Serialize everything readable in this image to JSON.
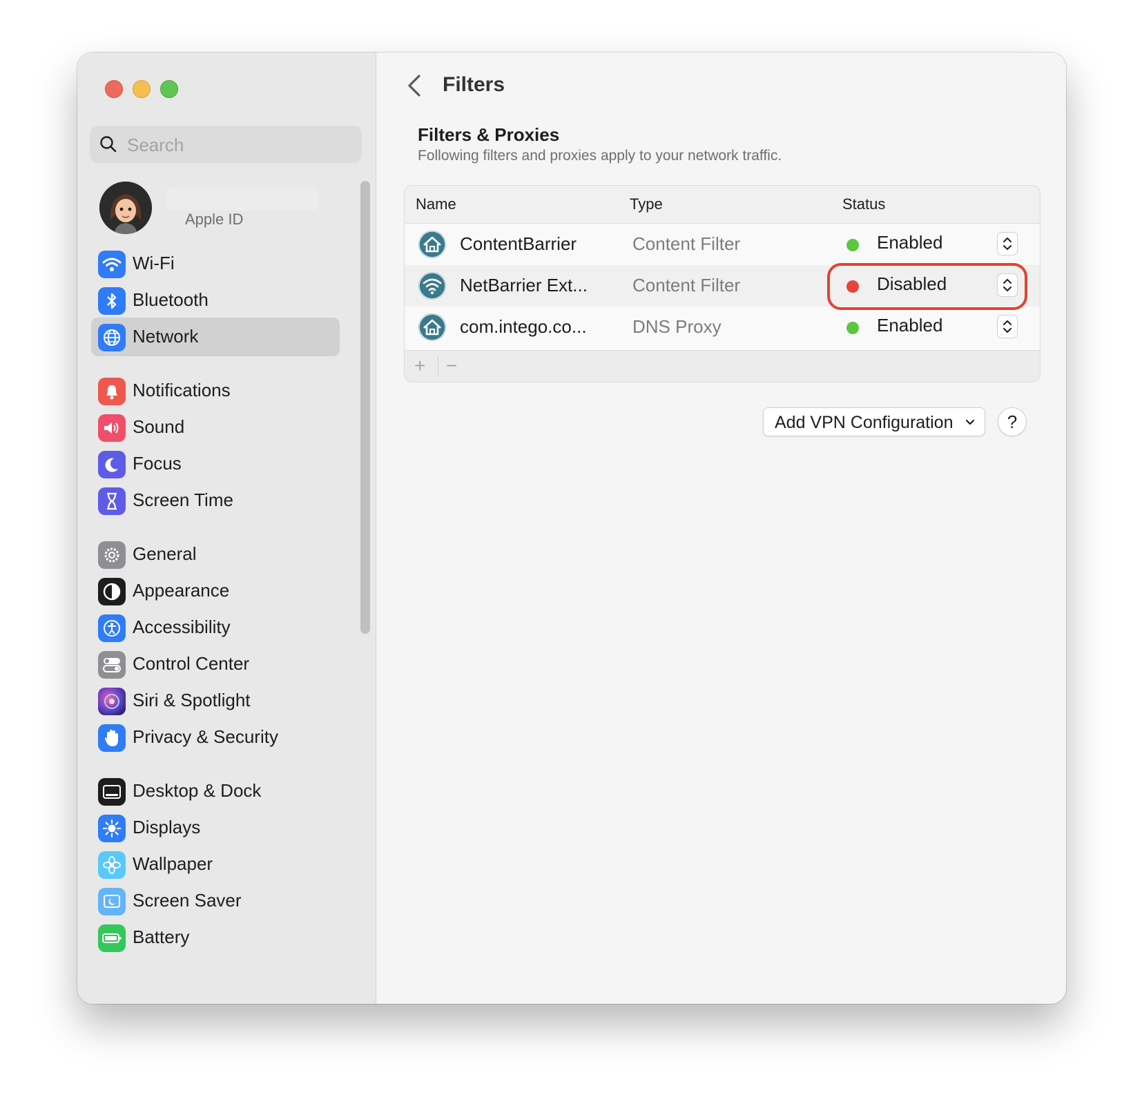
{
  "window": {
    "traffic_lights": [
      "close",
      "minimize",
      "zoom"
    ]
  },
  "sidebar": {
    "search_placeholder": "Search",
    "account_label": "Apple ID",
    "items": [
      {
        "label": "Wi-Fi",
        "icon": "wifi-icon",
        "color": "#2f7cf6",
        "selected": false
      },
      {
        "label": "Bluetooth",
        "icon": "bluetooth-icon",
        "color": "#2f7cf6",
        "selected": false
      },
      {
        "label": "Network",
        "icon": "globe-icon",
        "color": "#2f7cf6",
        "selected": true
      },
      {
        "label": "Notifications",
        "icon": "bell-icon",
        "color": "#f0584f",
        "selected": false
      },
      {
        "label": "Sound",
        "icon": "speaker-icon",
        "color": "#ef4f6a",
        "selected": false
      },
      {
        "label": "Focus",
        "icon": "moon-icon",
        "color": "#5e5ce6",
        "selected": false
      },
      {
        "label": "Screen Time",
        "icon": "hourglass-icon",
        "color": "#5e5ce6",
        "selected": false
      },
      {
        "label": "General",
        "icon": "gear-icon",
        "color": "#8e8e93",
        "selected": false
      },
      {
        "label": "Appearance",
        "icon": "appearance-icon",
        "color": "#1d1d1f",
        "selected": false
      },
      {
        "label": "Accessibility",
        "icon": "accessibility-icon",
        "color": "#2f7cf6",
        "selected": false
      },
      {
        "label": "Control Center",
        "icon": "toggles-icon",
        "color": "#8e8e93",
        "selected": false
      },
      {
        "label": "Siri & Spotlight",
        "icon": "siri-icon",
        "color": "#6b3fa0",
        "selected": false
      },
      {
        "label": "Privacy & Security",
        "icon": "hand-icon",
        "color": "#2f7cf6",
        "selected": false
      },
      {
        "label": "Desktop & Dock",
        "icon": "dock-icon",
        "color": "#1d1d1f",
        "selected": false
      },
      {
        "label": "Displays",
        "icon": "sun-icon",
        "color": "#2f7cf6",
        "selected": false
      },
      {
        "label": "Wallpaper",
        "icon": "flower-icon",
        "color": "#5ac8fa",
        "selected": false
      },
      {
        "label": "Screen Saver",
        "icon": "screensaver-icon",
        "color": "#64b5f6",
        "selected": false
      },
      {
        "label": "Battery",
        "icon": "battery-icon",
        "color": "#34c759",
        "selected": false
      }
    ]
  },
  "main": {
    "title": "Filters",
    "section_title": "Filters & Proxies",
    "section_subtitle": "Following filters and proxies apply to your network traffic.",
    "table": {
      "columns": [
        "Name",
        "Type",
        "Status"
      ],
      "rows": [
        {
          "name": "ContentBarrier",
          "type": "Content Filter",
          "status": "Enabled",
          "status_color": "#5ac83c",
          "icon": "contentbarrier-icon",
          "highlighted": false
        },
        {
          "name": "NetBarrier Ext...",
          "type": "Content Filter",
          "status": "Disabled",
          "status_color": "#e6443a",
          "icon": "netbarrier-icon",
          "highlighted": true
        },
        {
          "name": "com.intego.co...",
          "type": "DNS Proxy",
          "status": "Enabled",
          "status_color": "#5ac83c",
          "icon": "intego-icon",
          "highlighted": false
        }
      ],
      "add_label": "+",
      "remove_label": "−"
    },
    "vpn_button_label": "Add VPN Configuration",
    "help_label": "?",
    "highlight_color": "#e0442f"
  }
}
